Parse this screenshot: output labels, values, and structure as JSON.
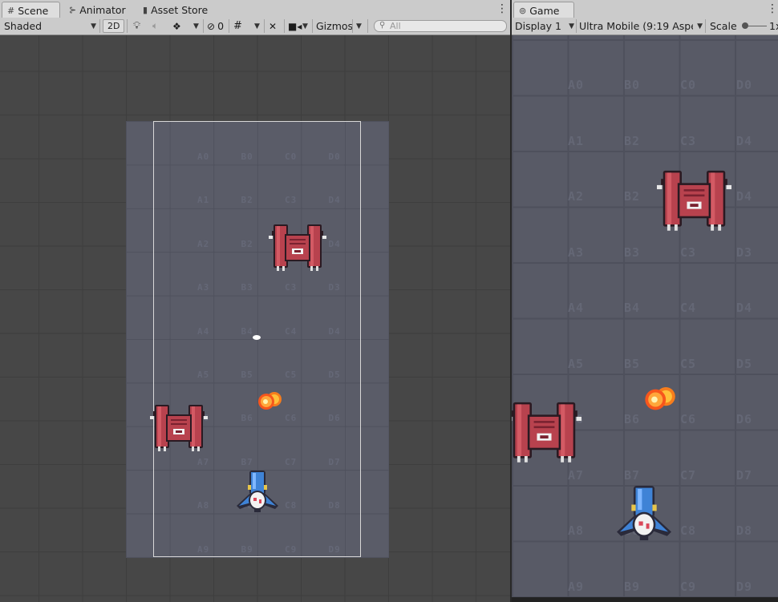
{
  "scene": {
    "tabs": [
      {
        "label": "Scene",
        "icon": "grid-icon"
      },
      {
        "label": "Animator",
        "icon": "animator-icon"
      },
      {
        "label": "Asset Store",
        "icon": "shopping-bag-icon"
      }
    ],
    "toolbar": {
      "shading_mode": "Shaded",
      "mode_2d": "2D",
      "hidden_count": "0",
      "gizmos": "Gizmos",
      "search_placeholder": "All"
    },
    "cell_labels": [
      [
        "A0",
        "B0",
        "C0",
        "D0"
      ],
      [
        "A1",
        "B2",
        "C3",
        "D4"
      ],
      [
        "A2",
        "B2",
        "C3",
        "D4"
      ],
      [
        "A3",
        "B3",
        "C3",
        "D3"
      ],
      [
        "A4",
        "B4",
        "C4",
        "D4"
      ],
      [
        "A5",
        "B5",
        "C5",
        "D5"
      ],
      [
        "A6",
        "B6",
        "C6",
        "D6"
      ],
      [
        "A7",
        "B7",
        "C7",
        "D7"
      ],
      [
        "A8",
        "B8",
        "C8",
        "D8"
      ],
      [
        "A9",
        "B9",
        "C9",
        "D9"
      ]
    ]
  },
  "game": {
    "tab": {
      "label": "Game",
      "icon": "gamepad-icon"
    },
    "toolbar": {
      "display": "Display 1",
      "aspect": "Ultra Mobile (9:19 Aspect)",
      "scale_label": "Scale",
      "scale_value": "1x"
    },
    "cell_labels": [
      [
        "A0",
        "B0",
        "C0",
        "D0"
      ],
      [
        "A1",
        "B2",
        "C3",
        "D4"
      ],
      [
        "A2",
        "B2",
        "C3",
        "D4"
      ],
      [
        "A3",
        "B3",
        "C3",
        "D3"
      ],
      [
        "A4",
        "B4",
        "C4",
        "D4"
      ],
      [
        "A5",
        "B5",
        "C5",
        "D5"
      ],
      [
        "A6",
        "B6",
        "C6",
        "D6"
      ],
      [
        "A7",
        "B7",
        "C7",
        "D7"
      ],
      [
        "A8",
        "B8",
        "C8",
        "D8"
      ],
      [
        "A9",
        "B9",
        "C9",
        "D9"
      ]
    ]
  },
  "colors": {
    "enemy_body": "#b8424e",
    "enemy_dark": "#7a2230",
    "player_blue": "#3f83d6",
    "fireball": "#f7a21c",
    "editor_bg": "#474747",
    "map_bg": "#585a66"
  }
}
